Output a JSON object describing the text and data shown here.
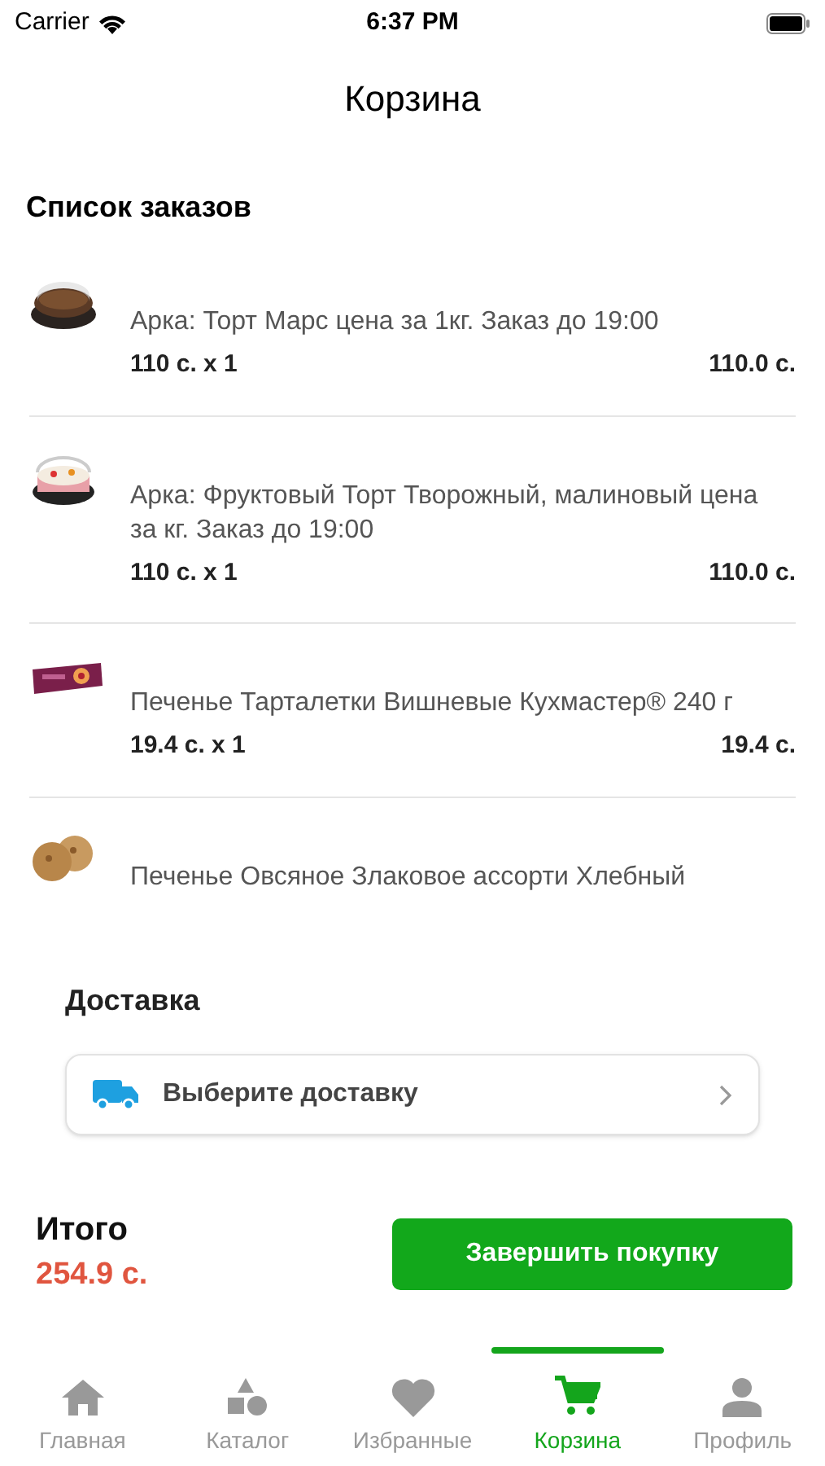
{
  "status_bar": {
    "carrier": "Carrier",
    "time": "6:37 PM"
  },
  "title": "Корзина",
  "orders": {
    "heading": "Список заказов",
    "items": [
      {
        "kind": "cake-dark",
        "name": "Арка: Торт Марс цена за 1кг. Заказ до 19:00",
        "unit_price": "110 с. x 1",
        "total": "110.0 с."
      },
      {
        "kind": "cake-fruit",
        "name": "Арка: Фруктовый Торт Творожный, малиновый цена за кг. Заказ до 19:00",
        "unit_price": "110 с. x 1",
        "total": "110.0 с."
      },
      {
        "kind": "cookie-pack",
        "name": "Печенье Тарталетки Вишневые Кухмастер® 240 г",
        "unit_price": "19.4 с. x 1",
        "total": "19.4 с."
      },
      {
        "kind": "cookies",
        "name": "Печенье Овсяное Злаковое ассорти Хлебный"
      }
    ]
  },
  "delivery": {
    "heading": "Доставка",
    "placeholder": "Выберите доставку"
  },
  "total": {
    "label": "Итого",
    "amount": "254.9 с."
  },
  "checkout_button": "Завершить покупку",
  "tabs": [
    {
      "kind": "home",
      "label": "Главная",
      "selected": false
    },
    {
      "kind": "catalog",
      "label": "Каталог",
      "selected": false
    },
    {
      "kind": "favorites",
      "label": "Избранные",
      "selected": false
    },
    {
      "kind": "cart",
      "label": "Корзина",
      "selected": true
    },
    {
      "kind": "profile",
      "label": "Профиль",
      "selected": false
    }
  ]
}
